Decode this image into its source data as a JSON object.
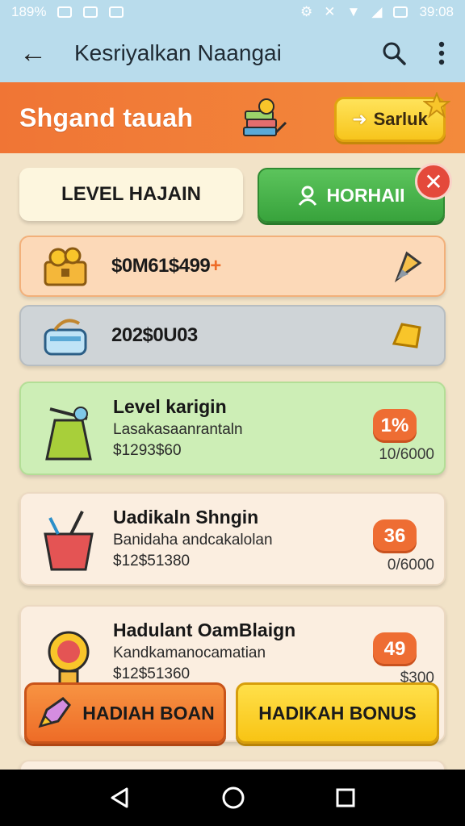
{
  "status_bar": {
    "left_text": "189%",
    "time": "39:08"
  },
  "app_bar": {
    "title": "Kesriyalkan Naangai"
  },
  "banner": {
    "title": "Shgand tauah",
    "button_label": "Sarluk"
  },
  "top_row": {
    "level_label": "LEVEL HAJAIN",
    "green_button_label": "HORHAII"
  },
  "balances": [
    {
      "value": "$0M61$499",
      "suffix": "+"
    },
    {
      "value": "202$0U03"
    }
  ],
  "cards": [
    {
      "title": "Level karigin",
      "subtitle": "Lasakasaanrantaln",
      "amount": "$1293$60",
      "badge": "1%",
      "progress": "10/6000"
    },
    {
      "title": "Uadikaln Shngin",
      "subtitle": "Banidaha andcakalolan",
      "amount": "$12$51380",
      "badge": "36",
      "progress": "0/6000"
    },
    {
      "title": "Hadulant OamBlaign",
      "subtitle": "Kandkamanocamatian",
      "amount": "$12$51360",
      "badge": "49",
      "progress": "$300"
    }
  ],
  "bottom_buttons": {
    "left_label": "HADIAH BOAN",
    "right_label": "HADIKAH BONUS"
  },
  "colors": {
    "orange": "#f07535",
    "green": "#38a33c",
    "yellow": "#f8c414",
    "sky": "#b9dcec"
  }
}
